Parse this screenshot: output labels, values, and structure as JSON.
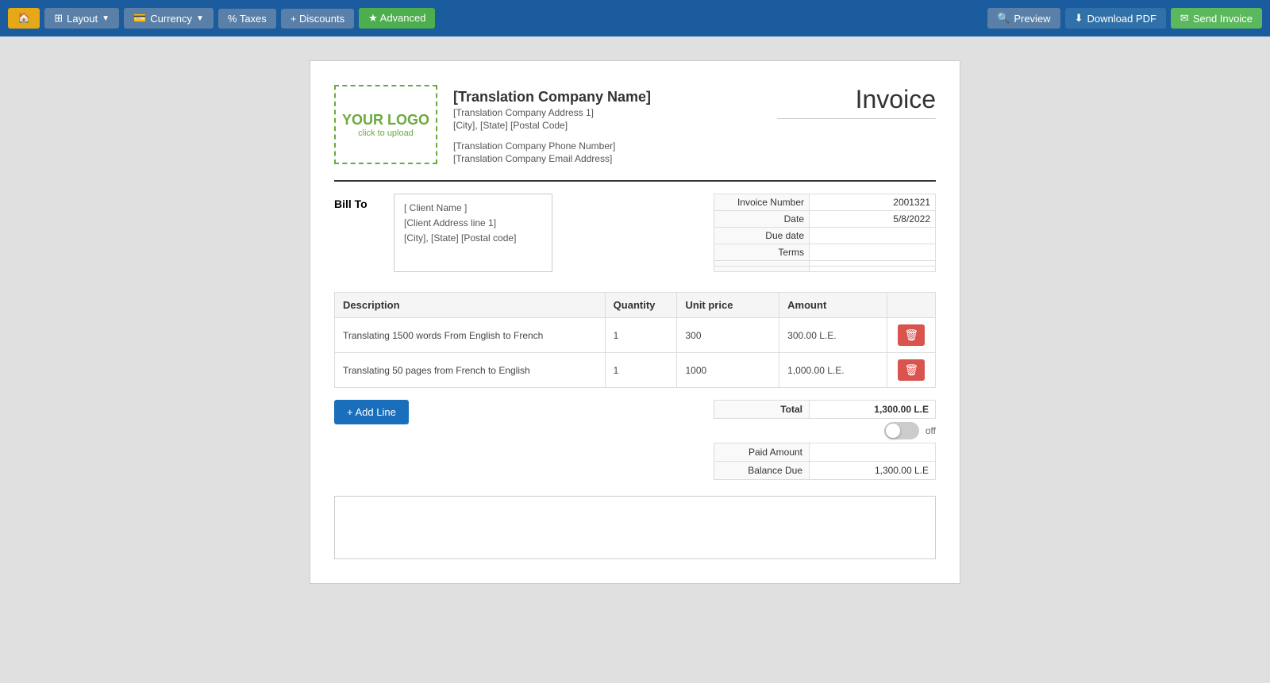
{
  "toolbar": {
    "home_label": "🏠",
    "layout_label": "Layout",
    "currency_label": "Currency",
    "taxes_label": "% Taxes",
    "discounts_label": "+ Discounts",
    "advanced_label": "★ Advanced",
    "preview_label": "Preview",
    "download_label": "Download PDF",
    "send_label": "Send Invoice"
  },
  "invoice": {
    "title": "Invoice",
    "logo_text": "YOUR LOGO",
    "logo_subtext": "click to upload",
    "company_name": "[Translation Company Name]",
    "company_address1": "[Translation Company Address 1]",
    "company_address2": "[City], [State] [Postal Code]",
    "company_phone": "[Translation Company Phone Number]",
    "company_email": "[Translation Company Email Address]",
    "bill_to_label": "Bill To",
    "client_name": "[ Client Name ]",
    "client_address1": "[Client Address line 1]",
    "client_address2": "[City], [State] [Postal code]",
    "meta": {
      "invoice_number_label": "Invoice Number",
      "invoice_number_value": "2001321",
      "date_label": "Date",
      "date_value": "5/8/2022",
      "due_date_label": "Due date",
      "due_date_value": "",
      "terms_label": "Terms",
      "terms_value": "",
      "extra1_label": "",
      "extra1_value": "",
      "extra2_label": "",
      "extra2_value": ""
    },
    "table": {
      "col_description": "Description",
      "col_quantity": "Quantity",
      "col_unit_price": "Unit price",
      "col_amount": "Amount",
      "rows": [
        {
          "description": "Translating 1500 words From English to French",
          "quantity": "1",
          "unit_price": "300",
          "amount": "300.00 L.E."
        },
        {
          "description": "Translating 50 pages from French to English",
          "quantity": "1",
          "unit_price": "1000",
          "amount": "1,000.00 L.E."
        }
      ]
    },
    "add_line_label": "+ Add Line",
    "toggle_label": "off",
    "totals": {
      "total_label": "Total",
      "total_value": "1,300.00 L.E",
      "paid_amount_label": "Paid Amount",
      "paid_amount_value": "",
      "balance_due_label": "Balance Due",
      "balance_due_value": "1,300.00 L.E"
    }
  }
}
